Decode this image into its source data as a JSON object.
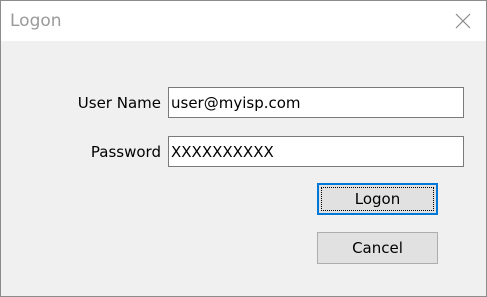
{
  "window": {
    "title": "Logon",
    "close_icon": "close-icon"
  },
  "form": {
    "username_label": "User Name",
    "username_value": "user@myisp.com",
    "password_label": "Password",
    "password_value": "XXXXXXXXXX"
  },
  "buttons": {
    "logon_label": "Logon",
    "cancel_label": "Cancel"
  },
  "colors": {
    "dialog_background": "#f0f0f0",
    "titlebar_background": "#ffffff",
    "default_button_border": "#0078d7"
  }
}
